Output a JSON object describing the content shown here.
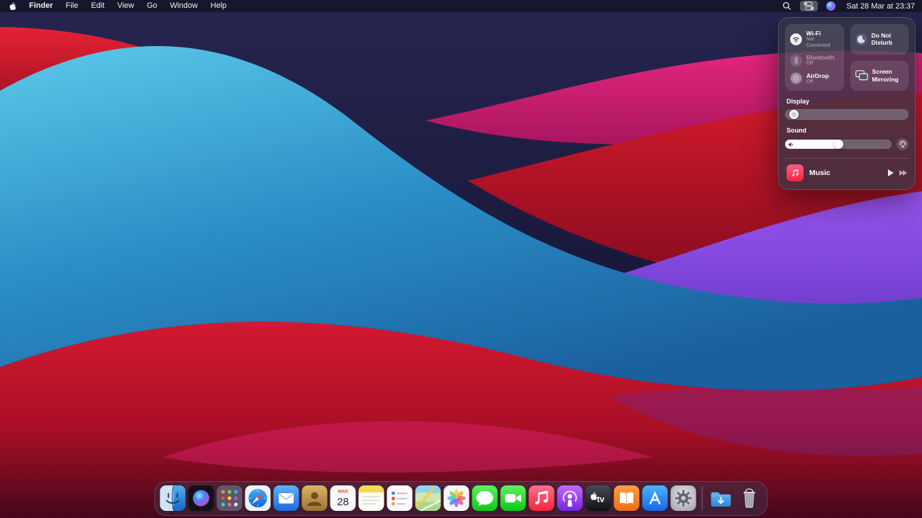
{
  "menu_bar": {
    "app_menus": [
      "Finder",
      "File",
      "Edit",
      "View",
      "Go",
      "Window",
      "Help"
    ],
    "active_app": "Finder",
    "clock": "Sat 28 Mar at 23:37",
    "status_icons": [
      "spotlight-search",
      "control-center",
      "siri"
    ]
  },
  "control_center": {
    "wifi_label": "Wi-Fi",
    "wifi_status": "Not Connected",
    "bluetooth_label": "Bluetooth",
    "bluetooth_status": "Off",
    "airdrop_label": "AirDrop",
    "airdrop_status": "Off",
    "dnd_label": "Do Not Disturb",
    "screen_mirroring_label": "Screen Mirroring",
    "display_label": "Display",
    "display_value_pct": 6,
    "sound_label": "Sound",
    "sound_value_pct": 50,
    "music_label": "Music"
  },
  "dock": {
    "items": [
      {
        "id": "finder",
        "label": "Finder",
        "running": true
      },
      {
        "id": "siri",
        "label": "Siri"
      },
      {
        "id": "launchpad",
        "label": "Launchpad"
      },
      {
        "id": "safari",
        "label": "Safari"
      },
      {
        "id": "mail",
        "label": "Mail"
      },
      {
        "id": "contacts",
        "label": "Contacts"
      },
      {
        "id": "calendar",
        "label": "Calendar",
        "badge_month": "MAR",
        "badge_day": "28"
      },
      {
        "id": "notes",
        "label": "Notes"
      },
      {
        "id": "reminders",
        "label": "Reminders"
      },
      {
        "id": "maps",
        "label": "Maps"
      },
      {
        "id": "photos",
        "label": "Photos"
      },
      {
        "id": "messages",
        "label": "Messages"
      },
      {
        "id": "facetime",
        "label": "FaceTime"
      },
      {
        "id": "music",
        "label": "Music"
      },
      {
        "id": "podcasts",
        "label": "Podcasts"
      },
      {
        "id": "tv",
        "label": "TV"
      },
      {
        "id": "books",
        "label": "Books"
      },
      {
        "id": "appstore",
        "label": "App Store"
      },
      {
        "id": "sysprefs",
        "label": "System Preferences"
      },
      {
        "id": "downloads",
        "label": "Downloads"
      },
      {
        "id": "trash",
        "label": "Trash"
      }
    ]
  },
  "colors": {
    "music_accent": "#fa2d48",
    "slider_fill": "#ffffff",
    "menubar_tint": "rgba(18,20,34,0.80)"
  }
}
